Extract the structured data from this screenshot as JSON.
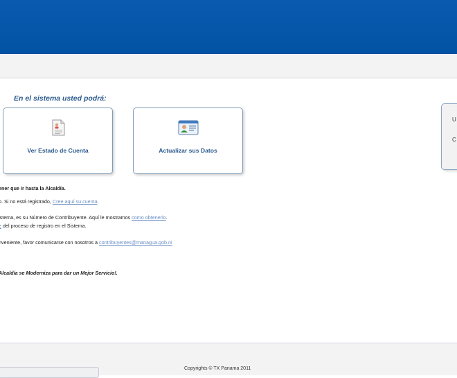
{
  "intro": {
    "heading": "En el sistema usted podrá:"
  },
  "cards": [
    {
      "label": "Ver Estado de Cuenta",
      "icon": "document-icon"
    },
    {
      "label": "Actualizar sus Datos",
      "icon": "id-card-icon"
    }
  ],
  "side_panel": {
    "item1": "U",
    "item2": "C"
  },
  "body_text": {
    "line1": "ener que ir hasta la Alcaldía.",
    "line2_prefix": "o. Si no está registrado, ",
    "line2_link": "Cree aquí su cuenta",
    "line2_suffix": ".",
    "line3_prefix": "istema, es su Número de Contribuyente. Aquí le mostramos ",
    "line3_link": "como obtenerlo",
    "line3_suffix": ".",
    "line4_link": "e",
    "line4_suffix": " del proceso de registro en el Sistema.",
    "line5_prefix": "nveniente, favor comunicarse con nosotros a ",
    "line5_link": "contribuyentes@managua.gob.ni",
    "line6": "Alcaldía se Moderniza para dar un Mejor Servicio!."
  },
  "footer": {
    "copyright": "Copyrights © TX Panama 2011"
  },
  "colors": {
    "banner": "#0252a4",
    "link": "#6b8fc4",
    "heading": "#2c5b8f"
  }
}
